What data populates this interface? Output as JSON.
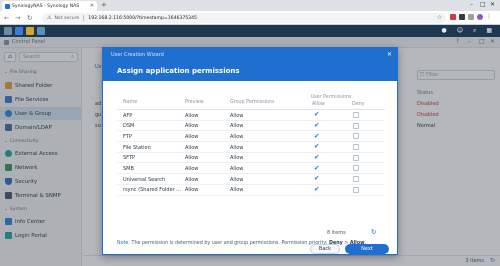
{
  "browser": {
    "tab_title": "SynologyNAS - Synology NAS",
    "not_secure": "Not secure",
    "url": "192.168.2.116:5000/?timestamp=1646375345"
  },
  "control_panel": {
    "title": "Control Panel",
    "search_placeholder": "Search",
    "sections": {
      "file_sharing": "File Sharing",
      "connectivity": "Connectivity",
      "system": "System"
    },
    "items": {
      "shared_folder": "Shared Folder",
      "file_services": "File Services",
      "user_group": "User & Group",
      "domain_ldap": "Domain/LDAP",
      "external_access": "External Access",
      "network": "Network",
      "security": "Security",
      "terminal_snmp": "Terminal & SNMP",
      "info_center": "Info Center",
      "login_portal": "Login Portal"
    },
    "main_tab": "Us",
    "filter_placeholder": "Filter",
    "background_rows": [
      "ad",
      "gu",
      "su"
    ],
    "status_header": "Status",
    "statuses": [
      {
        "text": "Disabled",
        "color": "#d9363e"
      },
      {
        "text": "Disabled",
        "color": "#d9363e"
      },
      {
        "text": "Normal",
        "color": "#2c3a47"
      }
    ],
    "footer_count": "3 items"
  },
  "wizard": {
    "window_name": "User Creation Wizard",
    "title": "Assign application permissions",
    "columns": {
      "name": "Name",
      "preview": "Preview",
      "group_permissions": "Group Permissions",
      "user_permissions": "User Permissions",
      "allow": "Allow",
      "deny": "Deny"
    },
    "rows": [
      {
        "name": "AFP",
        "preview": "Allow",
        "group": "Allow",
        "allow": true,
        "deny": false
      },
      {
        "name": "DSM",
        "preview": "Allow",
        "group": "Allow",
        "allow": true,
        "deny": false
      },
      {
        "name": "FTP",
        "preview": "Allow",
        "group": "Allow",
        "allow": true,
        "deny": false
      },
      {
        "name": "File Station",
        "preview": "Allow",
        "group": "Allow",
        "allow": true,
        "deny": false
      },
      {
        "name": "SFTP",
        "preview": "Allow",
        "group": "Allow",
        "allow": true,
        "deny": false
      },
      {
        "name": "SMB",
        "preview": "Allow",
        "group": "Allow",
        "allow": true,
        "deny": false
      },
      {
        "name": "Universal Search",
        "preview": "Allow",
        "group": "Allow",
        "allow": true,
        "deny": false
      },
      {
        "name": "rsync (Shared Folder ...",
        "preview": "Allow",
        "group": "Allow",
        "allow": true,
        "deny": false
      }
    ],
    "items_count": "8 items",
    "note_label": "Note:",
    "note_text": " The permission is determined by user and group permissions. Permission priority: ",
    "note_deny": "Deny",
    "note_gt": " > ",
    "note_allow": "Allow",
    "note_end": ".",
    "back_label": "Back",
    "next_label": "Next"
  },
  "accent_color": "#1f6fd0"
}
